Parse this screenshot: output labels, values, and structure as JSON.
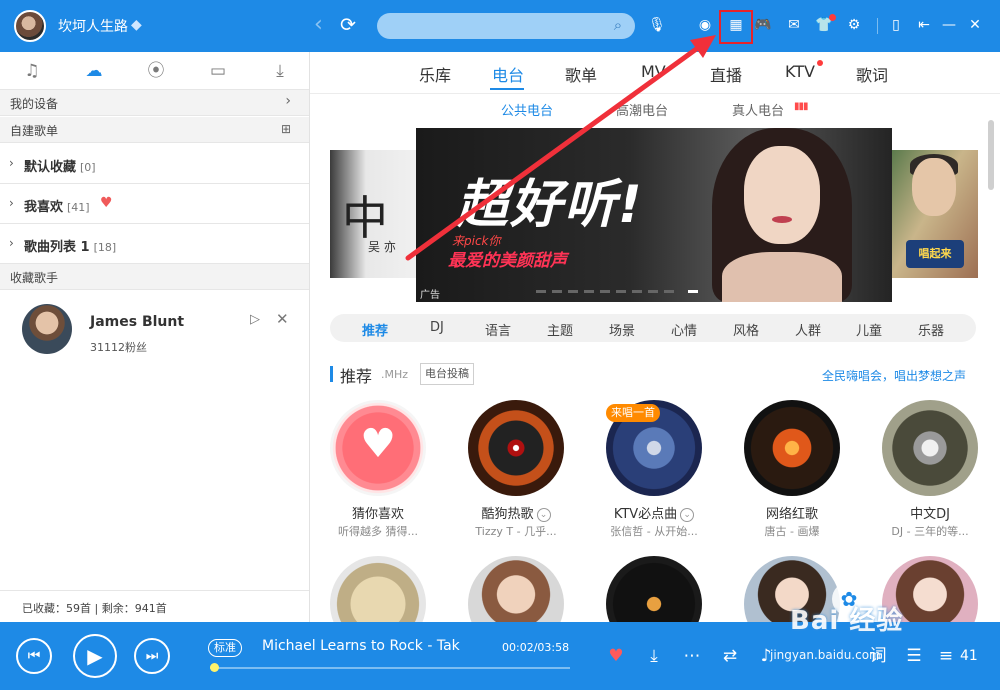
{
  "header": {
    "username": "坎坷人生路",
    "search": {
      "value": "",
      "placeholder": ""
    }
  },
  "left": {
    "my_devices": "我的设备",
    "custom_playlists": "自建歌单",
    "playlists": [
      {
        "name": "默认收藏",
        "count": "[0]"
      },
      {
        "name": "我喜欢",
        "count": "[41]"
      },
      {
        "name": "歌曲列表 1",
        "count": "[18]"
      }
    ],
    "fav_singers_label": "收藏歌手",
    "singer": {
      "name": "James Blunt",
      "fans": "31112粉丝"
    },
    "footer": "已收藏：59首  |  剩余：941首"
  },
  "main": {
    "tabs": [
      "乐库",
      "电台",
      "歌单",
      "MV",
      "直播",
      "KTV",
      "歌词"
    ],
    "active_tab": "电台",
    "sub_tabs": [
      "公共电台",
      "高潮电台",
      "真人电台"
    ],
    "banner": {
      "left_char": "中",
      "left_sub": "吴 亦",
      "right_tag": "唱起来",
      "title": "超好听!",
      "pick": "来pick你",
      "subtitle": "最爱的美颜甜声",
      "ad_label": "广告"
    },
    "categories": [
      "推荐",
      "DJ",
      "语言",
      "主题",
      "场景",
      "心情",
      "风格",
      "人群",
      "儿童",
      "乐器"
    ],
    "recommend": {
      "title": "推荐",
      "unit": ".MHz",
      "submit": "电台投稿",
      "link": "全民嗨唱会，唱出梦想之声",
      "badge": "来唱一首",
      "items": [
        {
          "name": "猜你喜欢",
          "desc": "听得越多 猜得..."
        },
        {
          "name": "酷狗热歌",
          "desc": "Tizzy T - 几乎..."
        },
        {
          "name": "KTV必点曲",
          "desc": "张信哲 - 从开始..."
        },
        {
          "name": "网络红歌",
          "desc": "唐古 - 画爆"
        },
        {
          "name": "中文DJ",
          "desc": "DJ - 三年的等..."
        }
      ]
    }
  },
  "player": {
    "quality": "标准",
    "song": "Michael Learns to Rock - Tak",
    "time": "00:02/03:58",
    "progress": 0.01,
    "volume": "41"
  },
  "watermark": {
    "brand": "Bai 经验",
    "url": "jingyan.baidu.com"
  },
  "colors": {
    "accent": "#1e8ae6",
    "highlight": "#e8232b",
    "heart": "#f05a5a"
  },
  "icons": [
    "music-note-icon",
    "cloud-icon",
    "radio-icon",
    "phone-icon",
    "download-icon",
    "refresh-icon",
    "search-icon",
    "mic-icon",
    "grid-icon",
    "gamepad-icon",
    "mail-icon",
    "shirt-icon",
    "gear-icon"
  ]
}
